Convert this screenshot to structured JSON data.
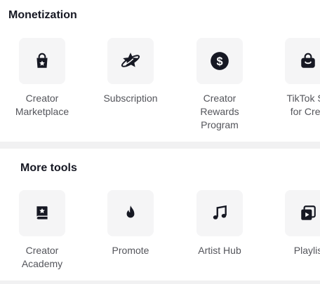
{
  "monetization": {
    "title": "Monetization",
    "items": [
      {
        "label": "Creator\nMarketplace",
        "icon": "shopping-bag-star-icon"
      },
      {
        "label": "Subscription",
        "icon": "star-planet-icon"
      },
      {
        "label": "Creator\nRewards\nProgram",
        "icon": "dollar-coin-icon"
      },
      {
        "label": "TikTok Sh\nfor Crea",
        "icon": "shop-bag-icon"
      }
    ]
  },
  "more_tools": {
    "title": "More tools",
    "items": [
      {
        "label": "Creator\nAcademy",
        "icon": "book-star-icon"
      },
      {
        "label": "Promote",
        "icon": "flame-icon"
      },
      {
        "label": "Artist Hub",
        "icon": "music-note-icon"
      },
      {
        "label": "Playlis",
        "icon": "playlist-icon"
      }
    ]
  }
}
